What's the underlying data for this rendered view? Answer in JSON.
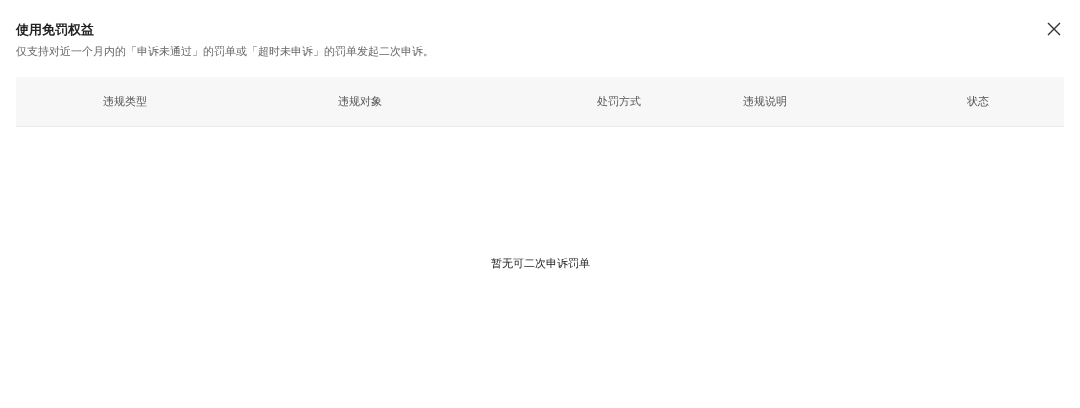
{
  "dialog": {
    "title": "使用免罚权益",
    "description": "仅支持对近一个月内的「申诉未通过」的罚单或「超时未申诉」的罚单发起二次申诉。"
  },
  "table": {
    "columns": [
      "违规类型",
      "违规对象",
      "处罚方式",
      "违规说明",
      "状态"
    ],
    "empty_text": "暂无可二次申诉罚单"
  }
}
